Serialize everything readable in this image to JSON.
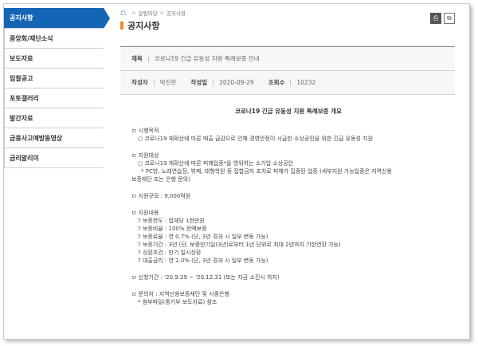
{
  "sidebar": {
    "items": [
      {
        "label": "공지사항",
        "active": true
      },
      {
        "label": "중앙회/재단소식"
      },
      {
        "label": "보도자료"
      },
      {
        "label": "입찰공고"
      },
      {
        "label": "포토갤러리"
      },
      {
        "label": "발간자료"
      },
      {
        "label": "금융사고예방동영상"
      },
      {
        "label": "금리알리미"
      }
    ]
  },
  "breadcrumb": {
    "home_icon": "home-icon",
    "level1": "알림마당",
    "level2": "공지사항",
    "separator": ">"
  },
  "page_title": "공지사항",
  "tools": {
    "print_icon": "printer-icon",
    "share_icon": "share-icon"
  },
  "accent_color": "#1565b6",
  "title_bar_color": "#f08c1e",
  "post": {
    "subject_label": "제목",
    "subject": "코로나19 긴급 유동성 지원 특례보증 안내",
    "author_label": "작성자",
    "author": "박진한",
    "date_label": "작성일",
    "date": "2020-09-29",
    "views_label": "조회수",
    "views": "10232"
  },
  "content": {
    "title": "코로나19 긴급 유동성 지원 특례보증 개요",
    "sections": [
      {
        "lines": [
          {
            "text": "ㅁ 시행목적",
            "indent": 1
          },
          {
            "text": "○ 코로나19 재확산에 따른 매출 급감으로 인해 경영안정이 시급한 소상공인을 위한 긴급 유동성 지원",
            "indent": 2
          }
        ]
      },
      {
        "lines": [
          {
            "text": "ㅁ 지원대상",
            "indent": 1
          },
          {
            "text": "○ 코로나19 재확산에 따른 피해업종*을 영위하는 소기업·소상공인",
            "indent": 2
          },
          {
            "text": "* PC방, 노래연습장, 뷔페, 대형학원 등 집합금지 조치로 피해가 집중된 업종 (세부지원 가능업종은 지역신용",
            "indent": 3
          },
          {
            "text": "보증재단 또는 은행 문의)",
            "indent": 1
          }
        ]
      },
      {
        "lines": [
          {
            "text": "ㅁ 지원규모 : 9,000억원",
            "indent": 1
          }
        ]
      },
      {
        "lines": [
          {
            "text": "ㅁ 지원내용",
            "indent": 1
          },
          {
            "text": "? 보증한도 : 업체당 1천만원",
            "indent": 2
          },
          {
            "text": "? 보증비율 : 100% 전액보증",
            "indent": 2
          },
          {
            "text": "? 보증료율 : 연 0.7% (단, 3년 경과 시 일부 변동 가능)",
            "indent": 2
          },
          {
            "text": "? 보증기간 : 3년 (단, 보증만기일(3년)로부터 1년 단위로 최대 2년까지 기한연장 가능)",
            "indent": 2
          },
          {
            "text": "? 상환조건 : 만기 일시상환",
            "indent": 2
          },
          {
            "text": "? 대출금리 : 연 2.0% (단, 3년 경과 시 일부 변동 가능)",
            "indent": 2
          }
        ]
      },
      {
        "lines": [
          {
            "text": "ㅁ 신청기간 : '20.9.29 ~ '20.12.31 (또는 자금 소진시 까지)",
            "indent": 1
          }
        ]
      },
      {
        "lines": [
          {
            "text": "ㅁ 문의처 : 지역신용보증재단 및 시중은행",
            "indent": 1
          },
          {
            "text": "* 첨부파일(중기부 보도자료) 참조",
            "indent": 2
          }
        ]
      }
    ]
  }
}
